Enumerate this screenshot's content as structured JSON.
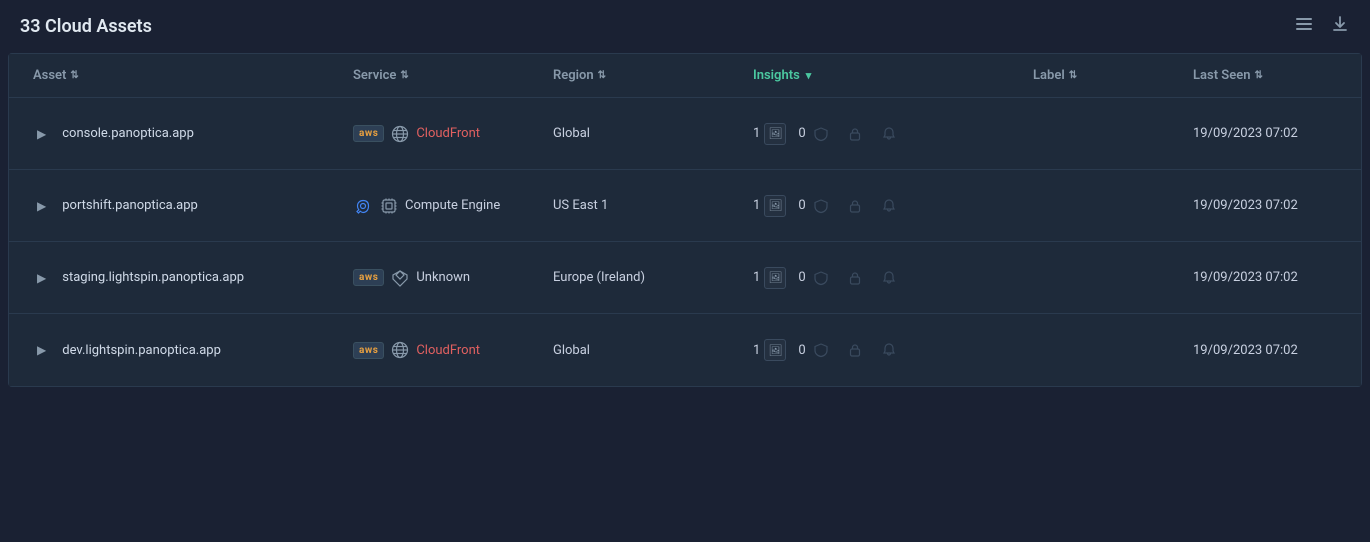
{
  "page": {
    "title": "33 Cloud Assets"
  },
  "header_icons": {
    "list_icon": "≡",
    "download_icon": "⬇"
  },
  "table": {
    "columns": [
      {
        "key": "asset",
        "label": "Asset",
        "active": false
      },
      {
        "key": "service",
        "label": "Service",
        "active": false
      },
      {
        "key": "region",
        "label": "Region",
        "active": false
      },
      {
        "key": "insights",
        "label": "Insights",
        "active": true
      },
      {
        "key": "label",
        "label": "Label",
        "active": false
      },
      {
        "key": "last_seen",
        "label": "Last Seen",
        "active": false
      }
    ],
    "rows": [
      {
        "asset": "console.panoptica.app",
        "cloud": "aws",
        "service_icon": "globe",
        "service_name": "CloudFront",
        "region": "Global",
        "insights_count": "1",
        "insights_shield_count": "0",
        "last_seen": "19/09/2023 07:02"
      },
      {
        "asset": "portshift.panoptica.app",
        "cloud": "gcp",
        "service_icon": "compute",
        "service_name": "Compute Engine",
        "region": "US East 1",
        "insights_count": "1",
        "insights_shield_count": "0",
        "last_seen": "19/09/2023 07:02"
      },
      {
        "asset": "staging.lightspin.panoptica.app",
        "cloud": "aws",
        "service_icon": "cube",
        "service_name": "Unknown",
        "region": "Europe (Ireland)",
        "insights_count": "1",
        "insights_shield_count": "0",
        "last_seen": "19/09/2023 07:02"
      },
      {
        "asset": "dev.lightspin.panoptica.app",
        "cloud": "aws",
        "service_icon": "globe",
        "service_name": "CloudFront",
        "region": "Global",
        "insights_count": "1",
        "insights_shield_count": "0",
        "last_seen": "19/09/2023 07:02"
      }
    ]
  }
}
